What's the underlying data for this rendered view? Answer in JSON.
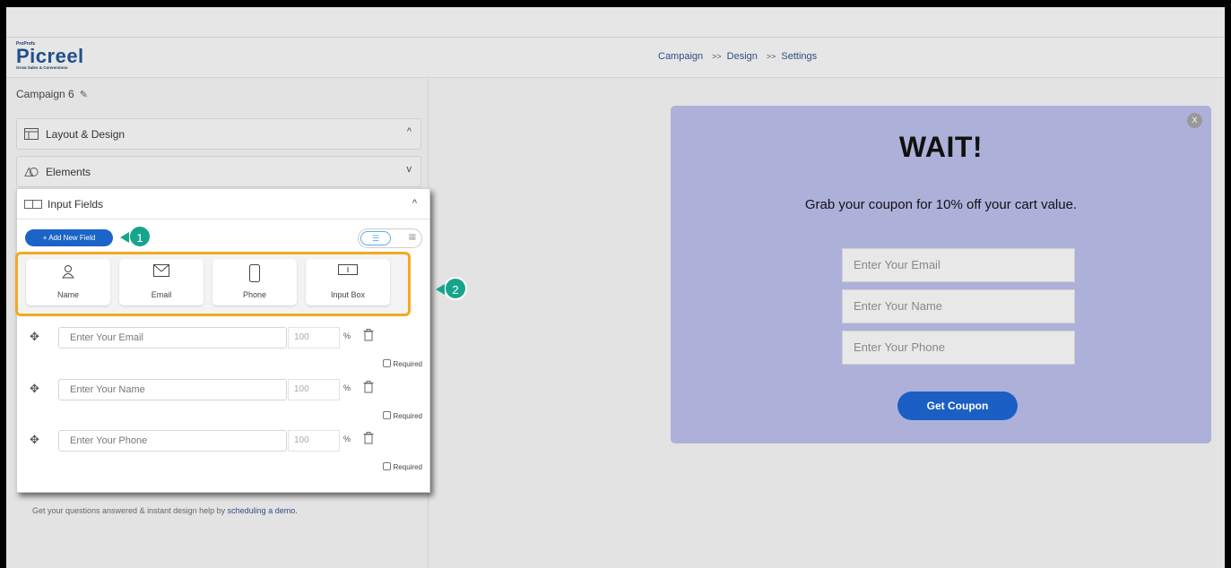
{
  "header": {
    "logo": {
      "prefix": "ProProfs",
      "name": "Picreel",
      "tagline": "Grow Sales & Conversions"
    },
    "breadcrumb": [
      "Campaign",
      "Design",
      "Settings"
    ],
    "separator": ">>"
  },
  "sidebar": {
    "campaign_name": "Campaign 6",
    "sections": {
      "layout": {
        "label": "Layout & Design",
        "chevron": "^"
      },
      "elements": {
        "label": "Elements",
        "chevron": "v"
      },
      "input_fields": {
        "label": "Input Fields",
        "chevron": "^"
      }
    },
    "add_field_label": "+ Add New Field",
    "field_types": [
      {
        "label": "Name",
        "icon": "user-icon"
      },
      {
        "label": "Email",
        "icon": "envelope-icon"
      },
      {
        "label": "Phone",
        "icon": "phone-icon"
      },
      {
        "label": "Input Box",
        "icon": "input-box-icon"
      }
    ],
    "fields": [
      {
        "placeholder": "Enter Your Email",
        "width": "100",
        "unit": "%",
        "required_label": "Required"
      },
      {
        "placeholder": "Enter Your Name",
        "width": "100",
        "unit": "%",
        "required_label": "Required"
      },
      {
        "placeholder": "Enter Your Phone",
        "width": "100",
        "unit": "%",
        "required_label": "Required"
      }
    ],
    "help_text": "Get your questions answered & instant design help by",
    "help_link": "scheduling a demo."
  },
  "callouts": [
    "1",
    "2"
  ],
  "popup": {
    "close_label": "X",
    "title": "WAIT!",
    "subtitle": "Grab your coupon for 10% off your cart value.",
    "inputs": [
      "Enter Your Email",
      "Enter Your Name",
      "Enter Your Phone"
    ],
    "button_label": "Get Coupon"
  },
  "colors": {
    "accent": "#1c64c8",
    "callout": "#16a58b",
    "highlight": "#f2a922",
    "popup_bg": "#adb1da"
  }
}
